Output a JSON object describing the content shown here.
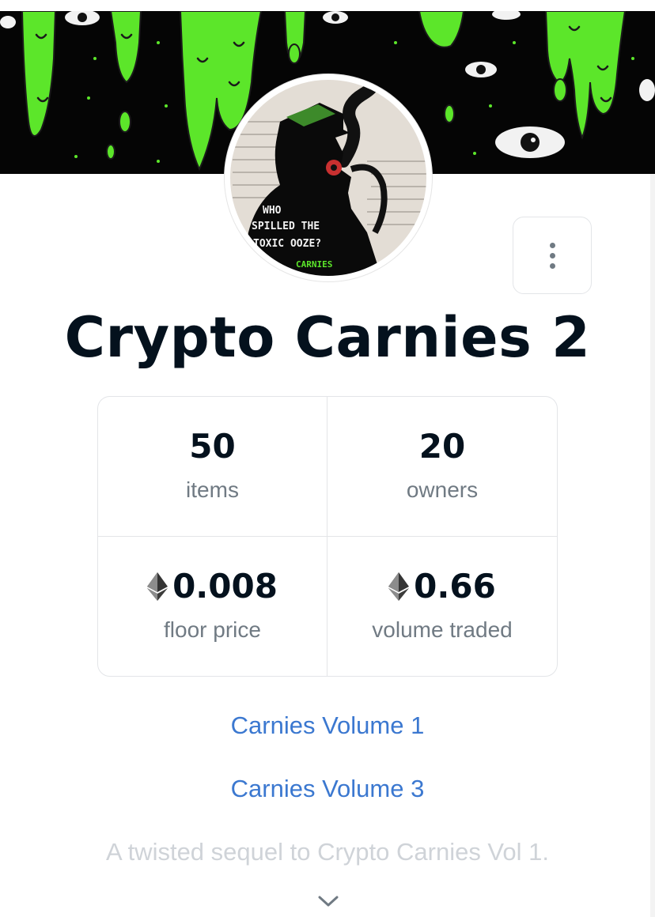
{
  "collection": {
    "title": "Crypto Carnies 2",
    "avatar_text": [
      "WHO",
      "SPILLED THE",
      "TOXIC OOZE?"
    ],
    "avatar_brand": "CARNIES"
  },
  "stats": [
    {
      "value": "50",
      "label": "items",
      "eth": false
    },
    {
      "value": "20",
      "label": "owners",
      "eth": false
    },
    {
      "value": "0.008",
      "label": "floor price",
      "eth": true
    },
    {
      "value": "0.66",
      "label": "volume traded",
      "eth": true
    }
  ],
  "links": [
    {
      "label": "Carnies Volume 1"
    },
    {
      "label": "Carnies Volume 3"
    }
  ],
  "description": "A twisted sequel to Crypto Carnies Vol 1.",
  "icons": {
    "more": "more-vertical-icon",
    "currency": "ethereum-icon",
    "expand": "chevron-down-icon"
  },
  "colors": {
    "text_primary": "#04111d",
    "text_secondary": "#707a83",
    "link": "#3b78d0",
    "slime": "#5ce62a",
    "border": "#e3e5e8"
  }
}
